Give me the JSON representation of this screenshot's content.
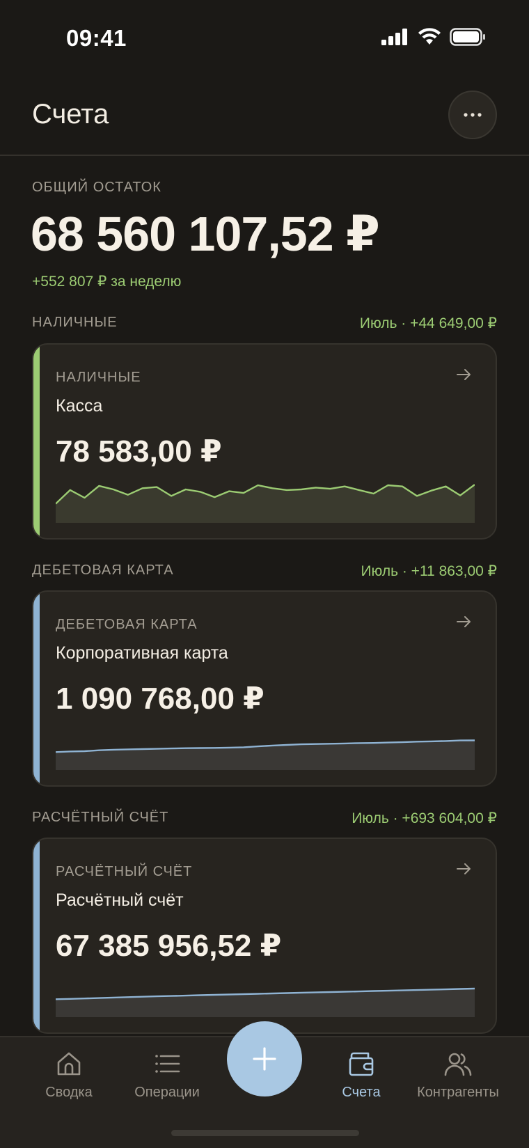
{
  "status": {
    "time": "09:41",
    "icons": [
      "signal-icon",
      "wifi-icon",
      "battery-icon"
    ]
  },
  "header": {
    "title": "Счета",
    "more_icon": "ellipsis-icon"
  },
  "summary": {
    "label": "ОБЩИЙ ОСТАТОК",
    "total": "68 560 107,52 ₽",
    "change": "+552 807 ₽ за неделю"
  },
  "sections": [
    {
      "title": "НАЛИЧНЫЕ",
      "delta": "Июль · +44 649,00 ₽",
      "card": {
        "type": "НАЛИЧНЫЕ",
        "name": "Касса",
        "balance": "78 583,00 ₽",
        "accent": "#9ccc73",
        "sparkline": [
          32,
          55,
          42,
          62,
          56,
          47,
          58,
          60,
          45,
          56,
          52,
          43,
          53,
          50,
          63,
          58,
          55,
          56,
          59,
          57,
          61,
          55,
          49,
          63,
          61,
          45,
          54,
          61,
          46,
          64
        ]
      }
    },
    {
      "title": "ДЕБЕТОВАЯ КАРТА",
      "delta": "Июль · +11 863,00 ₽",
      "card": {
        "type": "ДЕБЕТОВАЯ КАРТА",
        "name": "Корпоративная карта",
        "balance": "1 090 768,00 ₽",
        "accent": "#8fb3d3",
        "sparkline": [
          30,
          31,
          31.5,
          33,
          34,
          34.5,
          35,
          35.5,
          36,
          36.5,
          36.8,
          37,
          37.5,
          38,
          39.5,
          41,
          42,
          43,
          43.5,
          44,
          44.5,
          45,
          45.3,
          46,
          46.5,
          47.5,
          48,
          48.5,
          49.5,
          49.6
        ]
      }
    },
    {
      "title": "РАСЧЁТНЫЙ СЧЁТ",
      "delta": "Июль · +693 604,00 ₽",
      "card": {
        "type": "РАСЧЁТНЫЙ СЧЁТ",
        "name": "Расчётный счёт",
        "balance": "67 385 956,52 ₽",
        "accent": "#8fb3d3",
        "sparkline": [
          30,
          30.6,
          31.3,
          32,
          32.8,
          33.5,
          34.2,
          34.9,
          35.5,
          36.1,
          36.7,
          37.3,
          37.9,
          38.5,
          39.1,
          39.7,
          40.3,
          40.9,
          41.5,
          42,
          42.6,
          43.1,
          43.7,
          44.2,
          44.8,
          45.4,
          46,
          46.6,
          47.2,
          47.8
        ]
      }
    }
  ],
  "colors": {
    "positive": "#9ccc73",
    "accent_blue": "#a9c8e3",
    "background": "#1b1916",
    "card": "#27241f"
  },
  "tabs": [
    {
      "label": "Сводка",
      "icon": "home-icon",
      "active": false
    },
    {
      "label": "Операции",
      "icon": "list-icon",
      "active": false
    },
    {
      "label": "Счета",
      "icon": "wallet-icon",
      "active": true
    },
    {
      "label": "Контрагенты",
      "icon": "users-icon",
      "active": false
    }
  ],
  "fab": {
    "icon": "plus-icon"
  }
}
